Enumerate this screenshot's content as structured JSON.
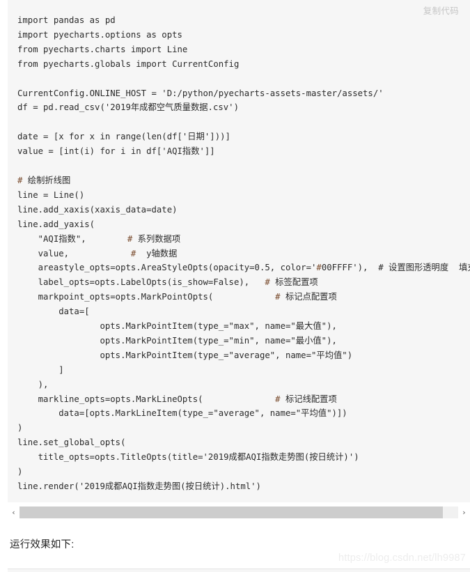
{
  "code_block": {
    "copy_label": "复制代码",
    "language": "python",
    "lines": [
      "import pandas as pd",
      "import pyecharts.options as opts",
      "from pyecharts.charts import Line",
      "from pyecharts.globals import CurrentConfig",
      "",
      "CurrentConfig.ONLINE_HOST = 'D:/python/pyecharts-assets-master/assets/'",
      "df = pd.read_csv('2019年成都空气质量数据.csv')",
      "",
      "date = [x for x in range(len(df['日期']))]",
      "value = [int(i) for i in df['AQI指数']]",
      "",
      "# 绘制折线图",
      "line = Line()",
      "line.add_xaxis(xaxis_data=date)",
      "line.add_yaxis(",
      "    \"AQI指数\",        # 系列数据项",
      "    value,            #  y轴数据",
      "    areastyle_opts=opts.AreaStyleOpts(opacity=0.5, color='#00FFFF'),  # 设置图形透明度  填充颜色",
      "    label_opts=opts.LabelOpts(is_show=False),   # 标签配置项",
      "    markpoint_opts=opts.MarkPointOpts(            # 标记点配置项",
      "        data=[",
      "                opts.MarkPointItem(type_=\"max\", name=\"最大值\"),",
      "                opts.MarkPointItem(type_=\"min\", name=\"最小值\"),",
      "                opts.MarkPointItem(type_=\"average\", name=\"平均值\")",
      "        ]",
      "    ),",
      "    markline_opts=opts.MarkLineOpts(              # 标记线配置项",
      "        data=[opts.MarkLineItem(type_=\"average\", name=\"平均值\")])",
      ")",
      "line.set_global_opts(",
      "    title_opts=opts.TitleOpts(title='2019成都AQI指数走势图(按日统计)')",
      ")",
      "line.render('2019成都AQI指数走势图(按日统计).html')"
    ]
  },
  "scrollbar": {
    "left_arrow": "‹",
    "right_arrow": "›",
    "orientation": "horizontal"
  },
  "caption": "运行效果如下:",
  "watermark": "https://blog.csdn.net/lh9987",
  "colors": {
    "code_background": "#f6f6f6",
    "page_background": "#ffffff",
    "code_text": "#2b2b2b",
    "comment_hash": "#7a4c2e",
    "copy_label": "#c6c6c6",
    "scrollbar_thumb": "#cdcdcd",
    "scrollbar_track": "#f1f1f1",
    "watermark": "#ededed"
  }
}
